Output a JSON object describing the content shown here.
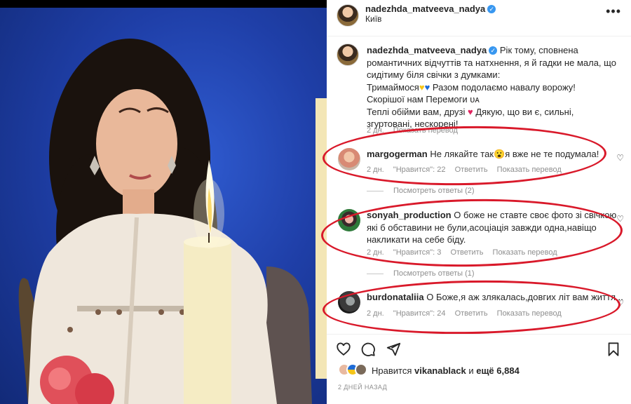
{
  "post": {
    "username": "nadezhda_matveeva_nadya",
    "location": "Київ",
    "more_icon": "more-horizontal-icon"
  },
  "caption": {
    "username": "nadezhda_matveeva_nadya",
    "line1": "Рік тому, сповнена романтичних відчуттів та натхнення, я й гадки не мала, що сидітиму біля свічки з думками:",
    "line2a": "Тримаймося",
    "line2b": "Разом подолаємо навалу ворожу!",
    "line3": "Скорішої нам Перемоги ᴜᴀ",
    "line4a": "Теплі обійми вам, друзі",
    "line4b": "Дякую, що ви є, сильні, згуртовані, нескорені!",
    "time": "2 дн.",
    "translate": "Показать перевод"
  },
  "comments": [
    {
      "username": "margogerman",
      "text_a": "Не лякайте так",
      "emoji": "😮",
      "text_b": "я вже не те подумала!",
      "time": "2 дн.",
      "likes": "\"Нравится\": 22",
      "reply": "Ответить",
      "translate": "Показать перевод",
      "replies": "Посмотреть ответы (2)"
    },
    {
      "username": "sonyah_production",
      "text": "О боже не ставте своє фото зі свічкою які б обставини не були,асоціація завжди одна,навіщо накликати на себе біду.",
      "time": "2 дн.",
      "likes": "\"Нравится\": 3",
      "reply": "Ответить",
      "translate": "Показать перевод",
      "replies": "Посмотреть ответы (1)"
    },
    {
      "username": "burdonataliia",
      "text": "О Боже,я аж злякалась,довгих літ вам життя...",
      "time": "2 дн.",
      "likes": "\"Нравится\": 24",
      "reply": "Ответить",
      "translate": "Показать перевод"
    }
  ],
  "footer": {
    "likes_prefix": "Нравится",
    "likes_user": "vikanablack",
    "likes_mid": "и",
    "likes_count": "ещё 6,884",
    "ago": "2 ДНЕЙ НАЗАД"
  },
  "icons": {
    "like": "heart-icon",
    "comment": "comment-icon",
    "share": "send-icon",
    "save": "bookmark-icon"
  },
  "colors": {
    "highlight_ring": "#d9192a",
    "verified": "#3897f0"
  }
}
